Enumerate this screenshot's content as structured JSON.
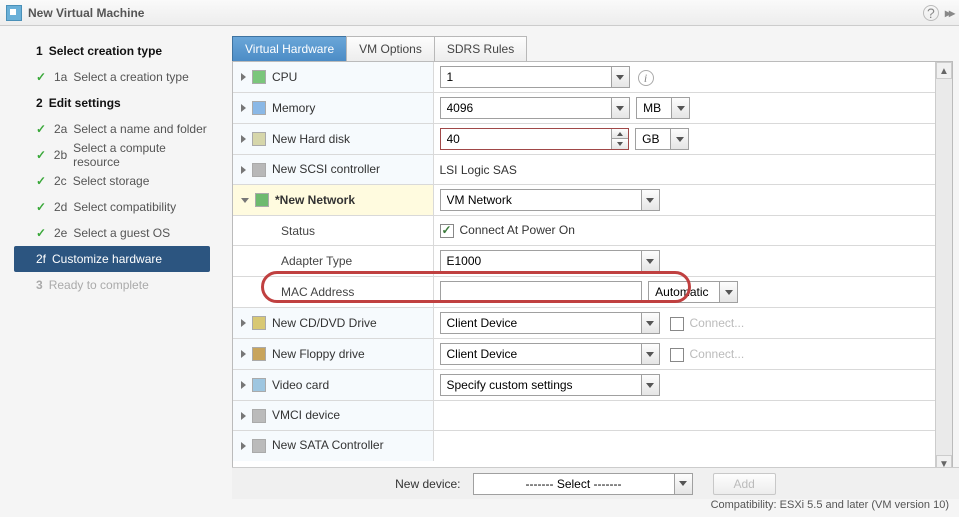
{
  "window": {
    "title": "New Virtual Machine"
  },
  "sidebar": {
    "s1": {
      "num": "1",
      "label": "Select creation type"
    },
    "s1a": {
      "num": "1a",
      "label": "Select a creation type"
    },
    "s2": {
      "num": "2",
      "label": "Edit settings"
    },
    "s2a": {
      "num": "2a",
      "label": "Select a name and folder"
    },
    "s2b": {
      "num": "2b",
      "label": "Select a compute resource"
    },
    "s2c": {
      "num": "2c",
      "label": "Select storage"
    },
    "s2d": {
      "num": "2d",
      "label": "Select compatibility"
    },
    "s2e": {
      "num": "2e",
      "label": "Select a guest OS"
    },
    "s2f": {
      "num": "2f",
      "label": "Customize hardware"
    },
    "s3": {
      "num": "3",
      "label": "Ready to complete"
    }
  },
  "tabs": {
    "hw": "Virtual Hardware",
    "opt": "VM Options",
    "sdrs": "SDRS Rules"
  },
  "rows": {
    "cpu": {
      "label": "CPU",
      "value": "1"
    },
    "mem": {
      "label": "Memory",
      "value": "4096",
      "unit": "MB"
    },
    "disk": {
      "label": "New Hard disk",
      "value": "40",
      "unit": "GB"
    },
    "scsi": {
      "label": "New SCSI controller",
      "value": "LSI Logic SAS"
    },
    "net": {
      "label": "*New Network",
      "value": "VM Network"
    },
    "net_status": {
      "label": "Status",
      "value": "Connect At Power On"
    },
    "net_adapter": {
      "label": "Adapter Type",
      "value": "E1000"
    },
    "net_mac": {
      "label": "MAC Address",
      "value": "",
      "mode": "Automatic"
    },
    "cd": {
      "label": "New CD/DVD Drive",
      "value": "Client Device",
      "connect": "Connect..."
    },
    "floppy": {
      "label": "New Floppy drive",
      "value": "Client Device",
      "connect": "Connect..."
    },
    "video": {
      "label": "Video card",
      "value": "Specify custom settings"
    },
    "vmci": {
      "label": "VMCI device"
    },
    "sata": {
      "label": "New SATA Controller"
    }
  },
  "addbar": {
    "label": "New device:",
    "select": "------- Select -------",
    "add": "Add"
  },
  "footer": "Compatibility: ESXi 5.5 and later (VM version 10)"
}
